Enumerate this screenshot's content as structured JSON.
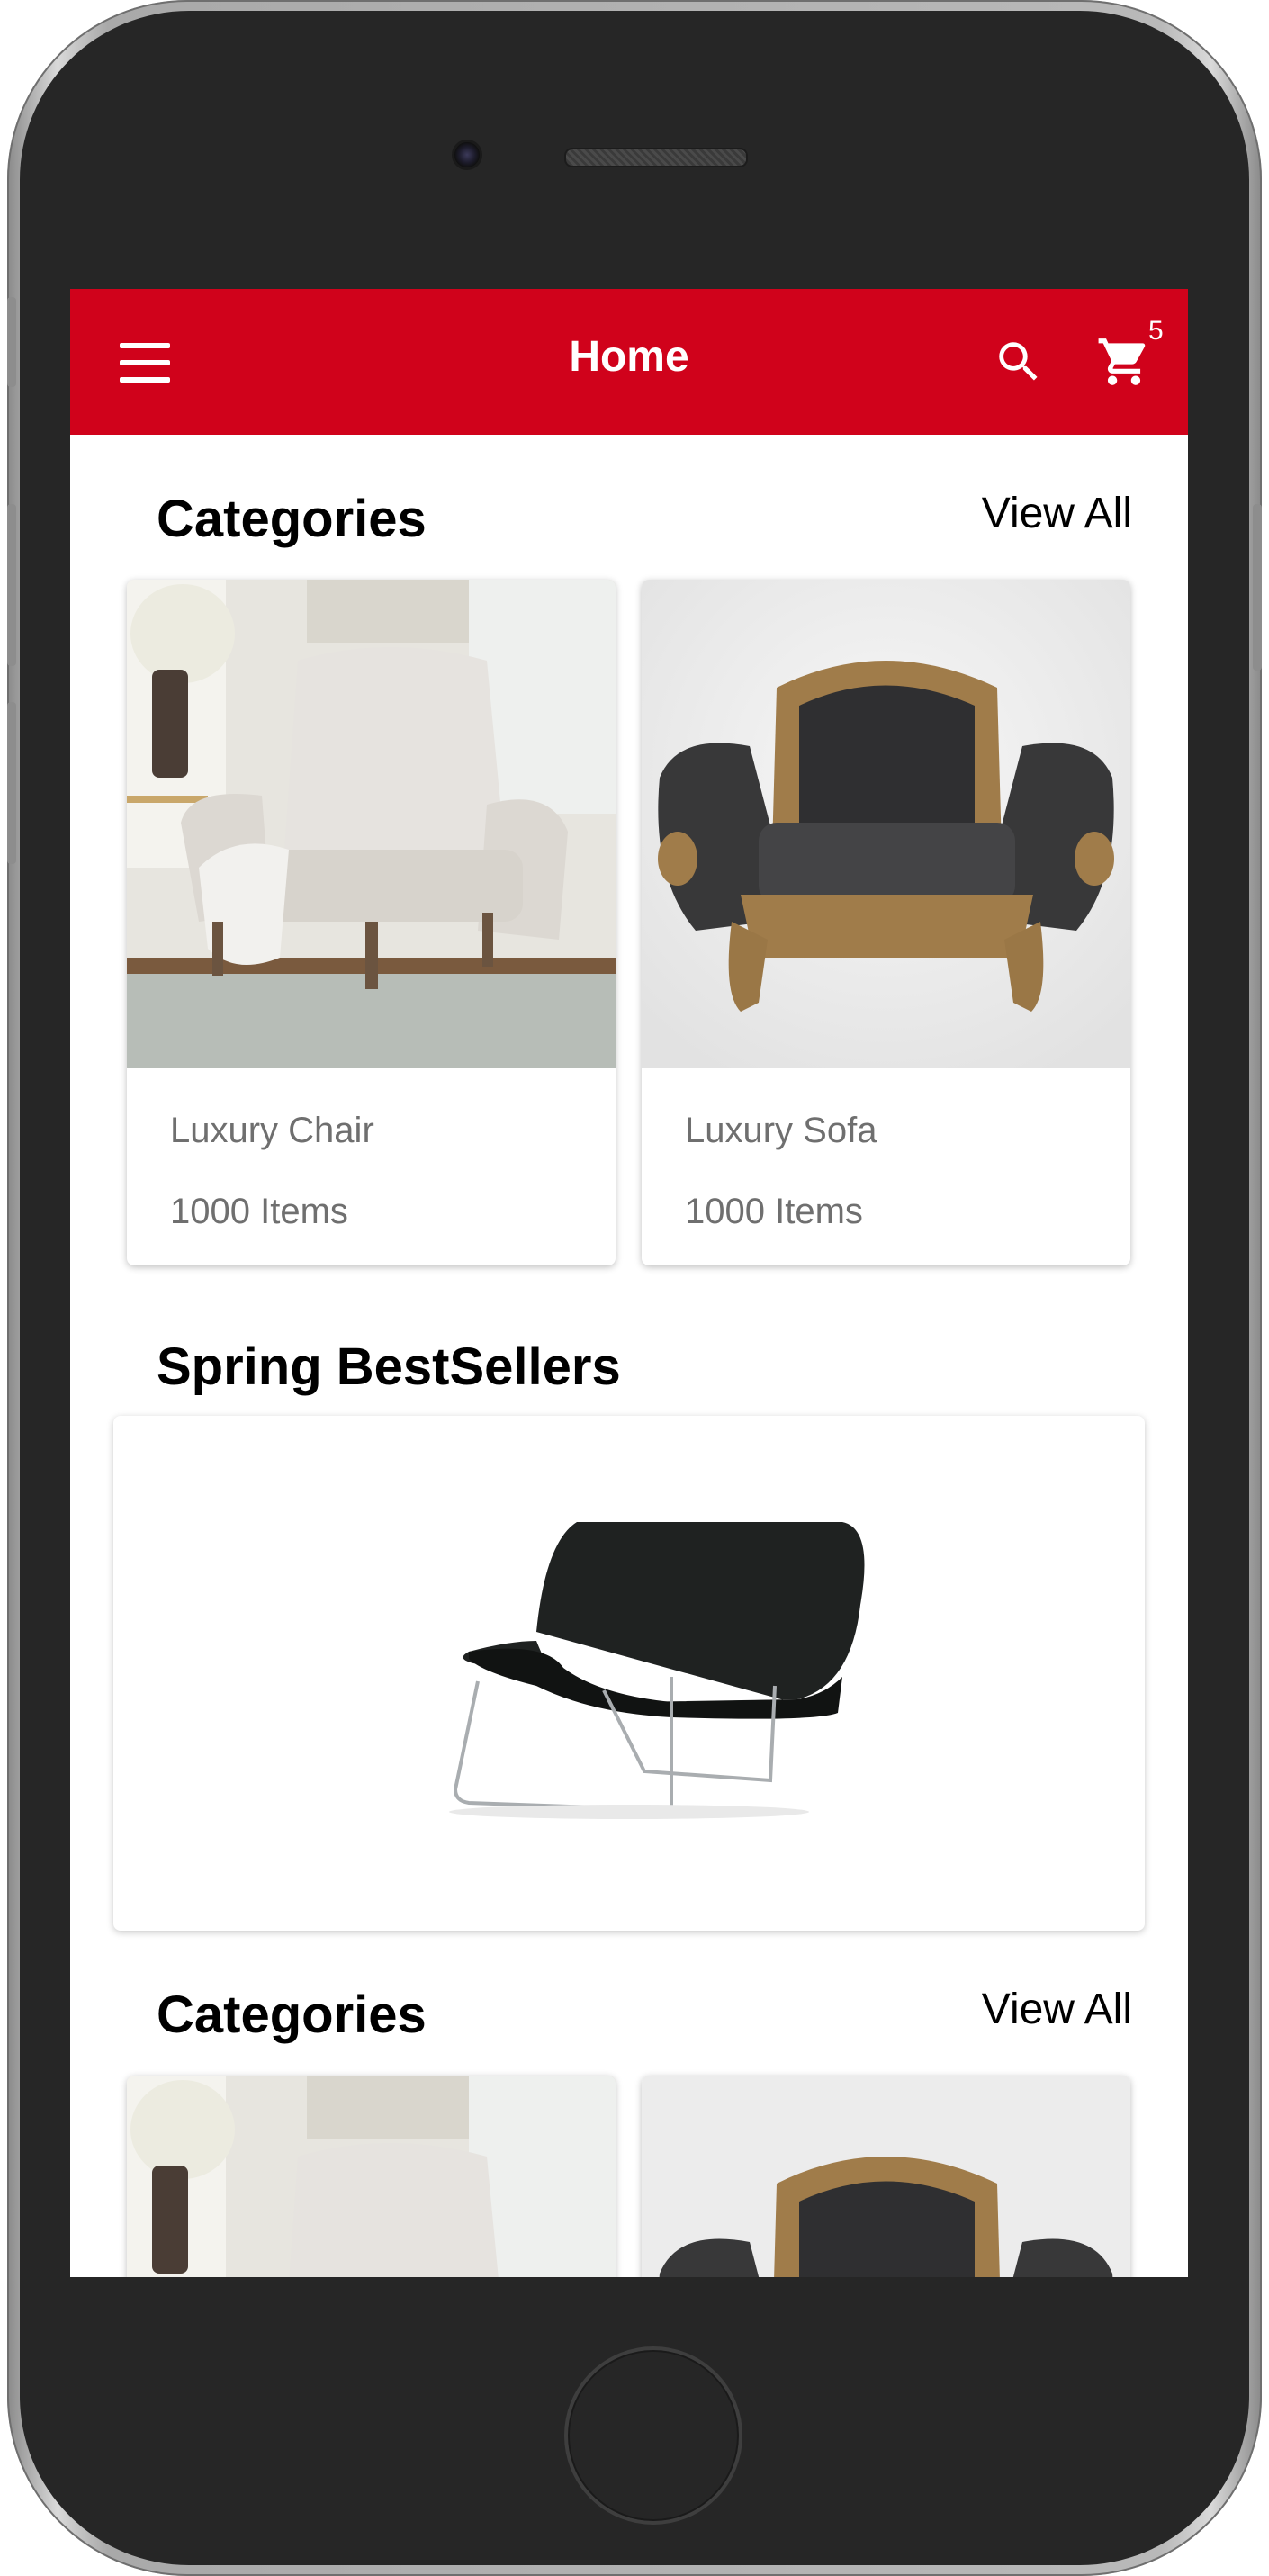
{
  "appbar": {
    "title": "Home",
    "cart_count": "5",
    "color": "#d0021b",
    "icons": [
      "menu-icon",
      "search-icon",
      "cart-icon"
    ]
  },
  "sections": [
    {
      "title": "Categories",
      "view_all": "View All",
      "items": [
        {
          "name": "Luxury Chair",
          "count": "1000 Items"
        },
        {
          "name": "Luxury Sofa",
          "count": "1000 Items"
        }
      ]
    },
    {
      "title": "Spring BestSellers"
    },
    {
      "title": "Categories",
      "view_all": "View All"
    }
  ]
}
